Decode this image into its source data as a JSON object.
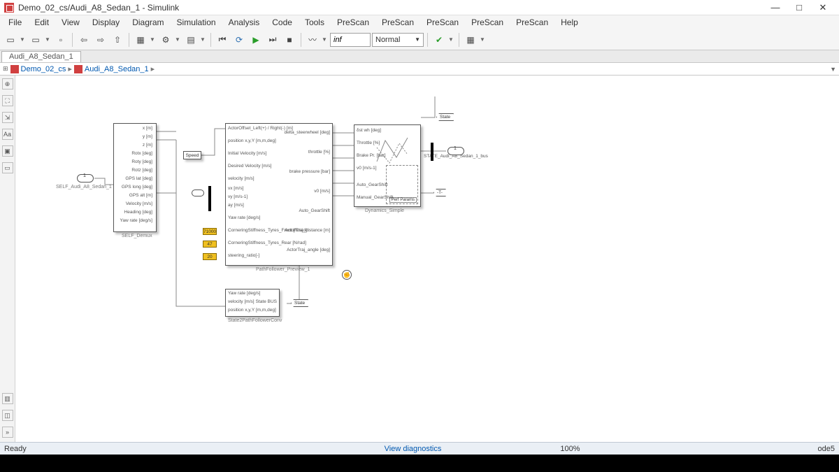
{
  "window": {
    "title": "Demo_02_cs/Audi_A8_Sedan_1 - Simulink"
  },
  "menu": [
    "File",
    "Edit",
    "View",
    "Display",
    "Diagram",
    "Simulation",
    "Analysis",
    "Code",
    "Tools",
    "PreScan",
    "PreScan",
    "PreScan",
    "PreScan",
    "PreScan",
    "Help"
  ],
  "toolbar": {
    "stoptime": "inf",
    "simmode": "Normal"
  },
  "tab": "Audi_A8_Sedan_1",
  "breadcrumb": {
    "root": "Demo_02_cs",
    "leaf": "Audi_A8_Sedan_1"
  },
  "status": {
    "ready": "Ready",
    "diagnostics": "View diagnostics",
    "zoom": "100%",
    "solver": "ode5"
  },
  "inport": {
    "label": "SELF_Audi_A8_Sedan_1",
    "num": "1"
  },
  "demux": {
    "label": "SELF_Demux",
    "signals": [
      "x [m]",
      "y [m]",
      "z [m]",
      "Rotx [deg]",
      "Roty [deg]",
      "Rotz [deg]",
      "GPS lat [deg]",
      "GPS long [deg]",
      "GPS alt [m]",
      "Velocity [m/s]",
      "Heading [deg]",
      "Yaw rate [deg/s]"
    ]
  },
  "speed": {
    "label": "Speed"
  },
  "pathfollower": {
    "label": "PathFollower_Preview_1",
    "inputs": [
      "ActorOffset_Left(+) / Right(-) [m]",
      "position x,y,Y [m,m,deg]",
      "Initial Velocity [m/s]",
      "Desired Velocity [m/s]",
      "velocity [m/s]",
      "vx [m/s]",
      "vy [m/s-1]",
      "ay [m/s]",
      "Yaw rate [deg/s]",
      "CorneringStiffness_Tyres_Front [N/rad]",
      "CorneringStiffness_Tyres_Rear [N/rad]",
      "steering_ratio[-]"
    ],
    "outputs": [
      "delta_steerwheel [deg]",
      "throttle [%]",
      "brake pressure [bar]",
      "v0 [m/s]",
      "Auto_GearShift",
      "ActorTraj_distance [m]",
      "ActorTraj_angle [deg]"
    ]
  },
  "consts": {
    "a": "71000",
    "b": "47",
    "c": "20"
  },
  "dynamics": {
    "label": "Dynamics_Simple",
    "inputs": [
      "δst wh [deg]",
      "Throttle [%]",
      "Brake Pr. [bar]",
      "v0 [m/s-1]",
      "Auto_GearShift",
      "Manual_GearShift"
    ],
    "output": "STATE_Audi_A8_Sedan_1_bus",
    "inset": "Perf Params"
  },
  "state2pf": {
    "label": "State2PathFollowerConv",
    "rows": [
      "Yaw rate [deg/s]",
      "velocity [m/s]",
      "position x,y,Y [m,m,deg]"
    ],
    "right": "State BUS"
  },
  "tags": {
    "state": "State",
    "state2": "State",
    "T": "-T-"
  },
  "outport": {
    "num": "1"
  }
}
